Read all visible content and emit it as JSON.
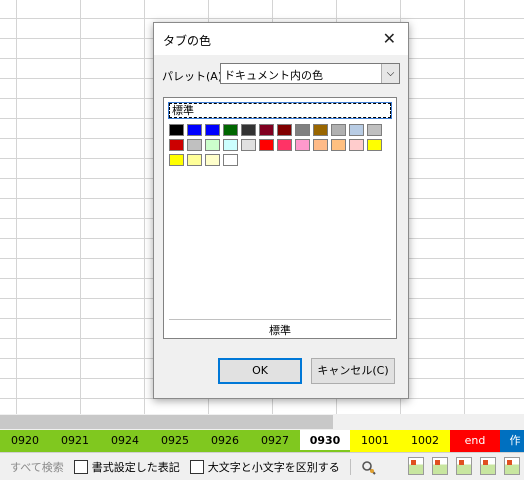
{
  "dialog": {
    "title": "タブの色",
    "palette_label": "パレット(A):",
    "palette_value": "ドキュメント内の色",
    "selected_label": "標準",
    "footer_label": "標準",
    "ok_label": "OK",
    "cancel_label": "キャンセル(C)"
  },
  "swatch_colors": [
    "#000000",
    "#0000ff",
    "#0000ff",
    "#006600",
    "#333333",
    "#800020",
    "#800000",
    "#808080",
    "#996600",
    "#b0b0b0",
    "#b8cce4",
    "#c0c0c0",
    "#cc0000",
    "#c0c0c0",
    "#ccffcc",
    "#ccffff",
    "#e0e0e0",
    "#ff0000",
    "#ff3366",
    "#ff99cc",
    "#ffbb88",
    "#ffc080",
    "#ffcccc",
    "#ffff00",
    "#ffff00",
    "#ffff99",
    "#ffffcc",
    "#ffffff"
  ],
  "sheet_tabs": [
    {
      "label": "0920",
      "style": "g"
    },
    {
      "label": "0921",
      "style": "g"
    },
    {
      "label": "0924",
      "style": "g"
    },
    {
      "label": "0925",
      "style": "g"
    },
    {
      "label": "0926",
      "style": "g"
    },
    {
      "label": "0927",
      "style": "g"
    },
    {
      "label": "0930",
      "style": "active"
    },
    {
      "label": "1001",
      "style": "y"
    },
    {
      "label": "1002",
      "style": "y"
    },
    {
      "label": "end",
      "style": "r"
    },
    {
      "label": "作",
      "style": "b"
    }
  ],
  "findbar": {
    "search_all": "すべて検索",
    "formatted_label": "書式設定した表記",
    "case_label": "大文字と小文字を区別する"
  }
}
